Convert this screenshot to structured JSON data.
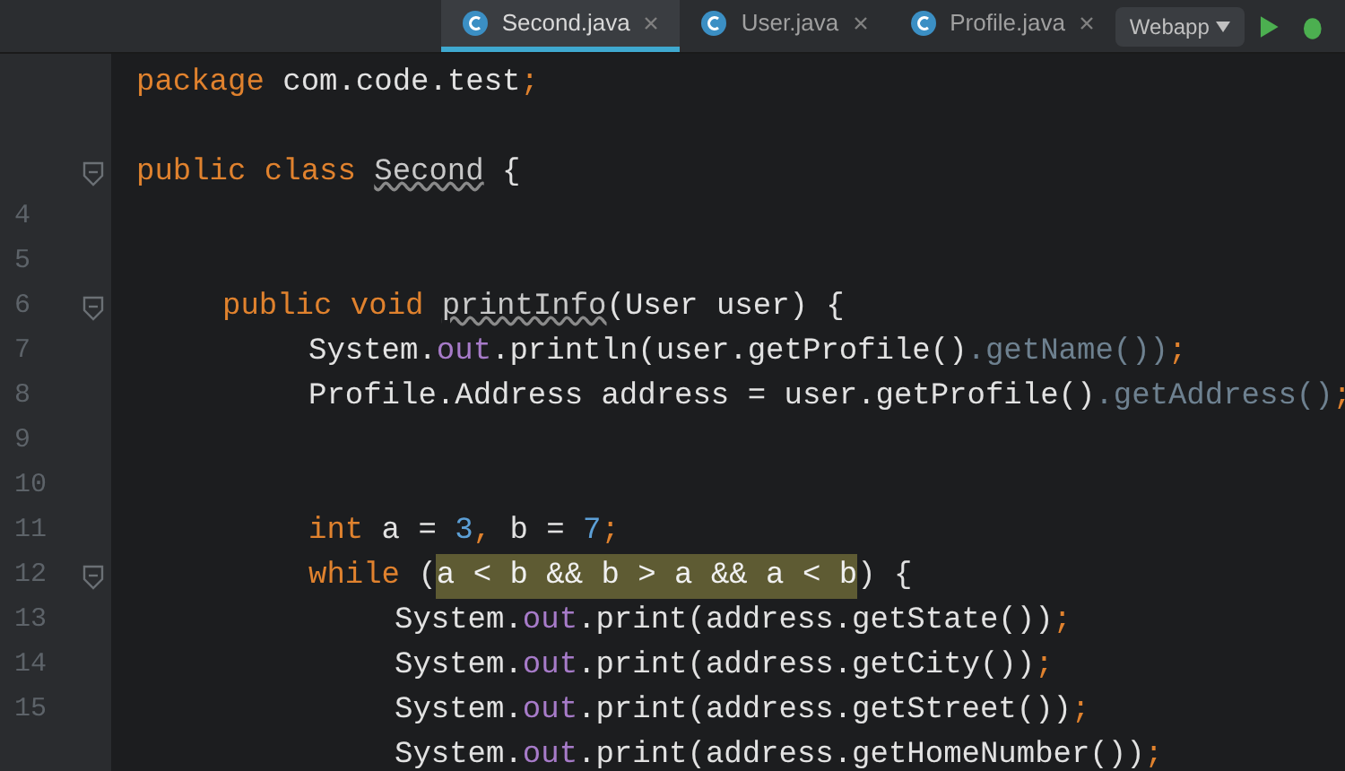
{
  "tabs": [
    {
      "label": "Second.java",
      "selected": true
    },
    {
      "label": "User.java",
      "selected": false
    },
    {
      "label": "Profile.java",
      "selected": false
    }
  ],
  "toolbar": {
    "run_config": "Webapp"
  },
  "code": [
    {
      "kind": "code",
      "tokens": [
        {
          "kind": "keyword",
          "text": "package"
        },
        {
          "kind": "plain",
          "text": " com.code.test"
        },
        {
          "kind": "punct",
          "text": ";"
        }
      ]
    },
    {
      "kind": "blank"
    },
    {
      "kind": "code",
      "tokens": [
        {
          "kind": "keyword",
          "text": "public class "
        },
        {
          "kind": "warning",
          "text": "Second"
        },
        {
          "kind": "plain",
          "text": " {"
        }
      ],
      "children": [
        {
          "kind": "blank",
          "number": "4"
        },
        {
          "kind": "blank",
          "number": "5"
        },
        {
          "kind": "code",
          "number": "6",
          "tokens": [
            {
              "kind": "keyword",
              "text": "public void "
            },
            {
              "kind": "warning",
              "text": "printInfo"
            },
            {
              "kind": "plain",
              "text": "(User user) {"
            }
          ],
          "children": [
            {
              "kind": "code",
              "number": "7",
              "tokens": [
                {
                  "kind": "plain",
                  "text": "System."
                },
                {
                  "kind": "field",
                  "text": "out"
                },
                {
                  "kind": "plain",
                  "text": ".println(user.getProfile()"
                },
                {
                  "kind": "dim",
                  "text": ".getName())"
                },
                {
                  "kind": "punct",
                  "text": ";"
                }
              ]
            },
            {
              "kind": "code",
              "number": "8",
              "tokens": [
                {
                  "kind": "plain",
                  "text": "Profile.Address address = user.getProfile()"
                },
                {
                  "kind": "dim",
                  "text": ".getAddress()"
                },
                {
                  "kind": "punct",
                  "text": ";"
                }
              ]
            },
            {
              "kind": "blank",
              "number": "9"
            },
            {
              "kind": "blank",
              "number": "10"
            },
            {
              "kind": "code",
              "number": "11",
              "tokens": [
                {
                  "kind": "keyword",
                  "text": "int"
                },
                {
                  "kind": "plain",
                  "text": " a = "
                },
                {
                  "kind": "number",
                  "text": "3"
                },
                {
                  "kind": "punct",
                  "text": ","
                },
                {
                  "kind": "plain",
                  "text": " b = "
                },
                {
                  "kind": "number",
                  "text": "7"
                },
                {
                  "kind": "punct",
                  "text": ";"
                }
              ]
            },
            {
              "kind": "code",
              "number": "12",
              "tokens": [
                {
                  "kind": "keyword",
                  "text": "while"
                },
                {
                  "kind": "plain",
                  "text": " ("
                },
                {
                  "kind": "highlight",
                  "text": "a < b && b > a && a < b"
                },
                {
                  "kind": "plain",
                  "text": ") {"
                }
              ],
              "children": [
                {
                  "kind": "code",
                  "number": "13",
                  "tokens": [
                    {
                      "kind": "plain",
                      "text": "System."
                    },
                    {
                      "kind": "field",
                      "text": "out"
                    },
                    {
                      "kind": "plain",
                      "text": ".print(address.getState())"
                    },
                    {
                      "kind": "punct",
                      "text": ";"
                    }
                  ]
                },
                {
                  "kind": "code",
                  "number": "14",
                  "tokens": [
                    {
                      "kind": "plain",
                      "text": "System."
                    },
                    {
                      "kind": "field",
                      "text": "out"
                    },
                    {
                      "kind": "plain",
                      "text": ".print(address.getCity())"
                    },
                    {
                      "kind": "punct",
                      "text": ";"
                    }
                  ]
                },
                {
                  "kind": "code",
                  "number": "15",
                  "tokens": [
                    {
                      "kind": "plain",
                      "text": "System."
                    },
                    {
                      "kind": "field",
                      "text": "out"
                    },
                    {
                      "kind": "plain",
                      "text": ".print(address.getStreet())"
                    },
                    {
                      "kind": "punct",
                      "text": ";"
                    }
                  ]
                },
                {
                  "kind": "code",
                  "tokens": [
                    {
                      "kind": "plain",
                      "text": "System."
                    },
                    {
                      "kind": "field",
                      "text": "out"
                    },
                    {
                      "kind": "plain",
                      "text": ".print(address.getHomeNumber())"
                    },
                    {
                      "kind": "punct",
                      "text": ";"
                    }
                  ]
                }
              ]
            }
          ]
        }
      ]
    }
  ]
}
